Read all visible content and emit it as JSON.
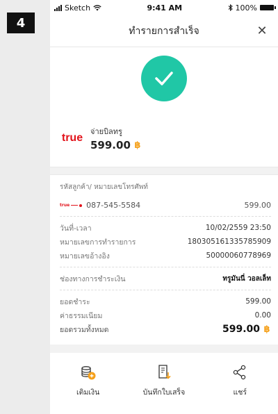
{
  "step_number": "4",
  "status_bar": {
    "carrier": "Sketch",
    "time": "9:41 AM",
    "battery": "100%"
  },
  "header": {
    "title": "ทำรายการสำเร็จ",
    "close": "✕"
  },
  "biller": {
    "logo_text": "true",
    "name": "จ่ายบิลทรู",
    "amount": "599.00"
  },
  "currency_symbol": "฿",
  "details": {
    "caption": "รหัสลูกค้า/ หมายเลขโทรศัพท์",
    "phone_logo_text": "true",
    "phone_number": "087-545-5584",
    "phone_amount": "599.00",
    "datetime_label": "วันที่-เวลา",
    "datetime_value": "10/02/2559 23:50",
    "txn_label": "หมายเลขการทำรายการ",
    "txn_value": "180305161335785909",
    "ref_label": "หมายเลขอ้างอิง",
    "ref_value": "50000060778969",
    "channel_label": "ช่องทางการชำระเงิน",
    "channel_value": "ทรูมันนี่ วอลเล็ท",
    "pay_label": "ยอดชำระ",
    "pay_value": "599.00",
    "fee_label": "ค่าธรรมเนียม",
    "fee_value": "0.00",
    "total_label": "ยอดรวมทั้งหมด",
    "total_value": "599.00"
  },
  "actions": [
    {
      "label": "เติมเงิน",
      "icon": "topup-coins-icon"
    },
    {
      "label": "บันทึกใบเสร็จ",
      "icon": "save-receipt-icon"
    },
    {
      "label": "แชร์",
      "icon": "share-icon"
    }
  ],
  "colors": {
    "success": "#20c7a6",
    "brand": "#e2131b",
    "currency": "#f5a01a"
  }
}
